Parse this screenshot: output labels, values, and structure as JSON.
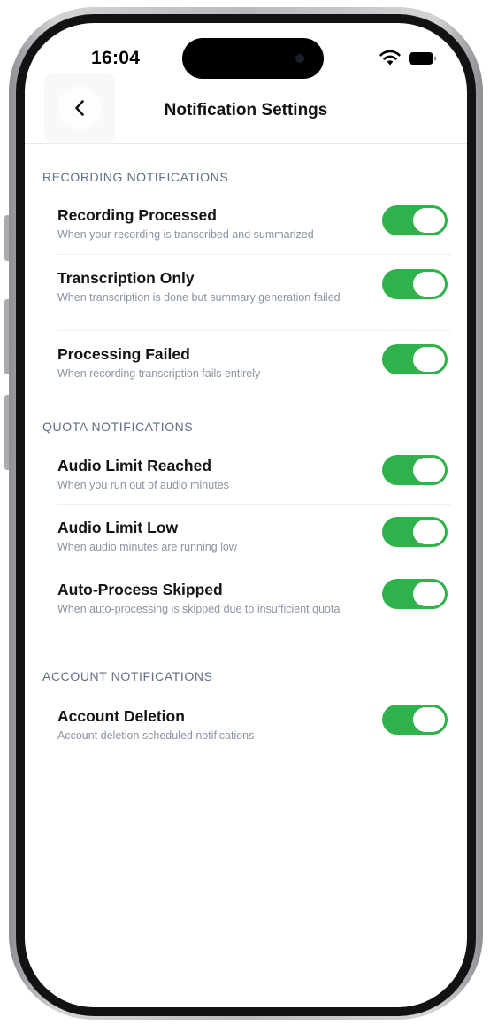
{
  "status_bar": {
    "time": "16:04",
    "signal": "....",
    "icons": [
      "wifi-icon",
      "battery-icon"
    ]
  },
  "nav": {
    "back_icon": "chevron-left-icon",
    "title": "Notification Settings"
  },
  "colors": {
    "toggle_on": "#2fb14c",
    "section_header": "#5f6f86",
    "description": "#8b94a3"
  },
  "sections": [
    {
      "header": "RECORDING NOTIFICATIONS",
      "items": [
        {
          "title": "Recording Processed",
          "description": "When your recording is transcribed and summarized",
          "enabled": true
        },
        {
          "title": "Transcription Only",
          "description": "When transcription is done but summary generation failed",
          "enabled": true
        },
        {
          "title": "Processing Failed",
          "description": "When recording transcription fails entirely",
          "enabled": true
        }
      ]
    },
    {
      "header": "QUOTA NOTIFICATIONS",
      "items": [
        {
          "title": "Audio Limit Reached",
          "description": "When you run out of audio minutes",
          "enabled": true
        },
        {
          "title": "Audio Limit Low",
          "description": "When audio minutes are running low",
          "enabled": true
        },
        {
          "title": "Auto-Process Skipped",
          "description": "When auto-processing is skipped due to insufficient quota",
          "enabled": true
        }
      ]
    },
    {
      "header": "ACCOUNT NOTIFICATIONS",
      "items": [
        {
          "title": "Account Deletion",
          "description": "Account deletion scheduled notifications",
          "enabled": true
        }
      ]
    }
  ]
}
